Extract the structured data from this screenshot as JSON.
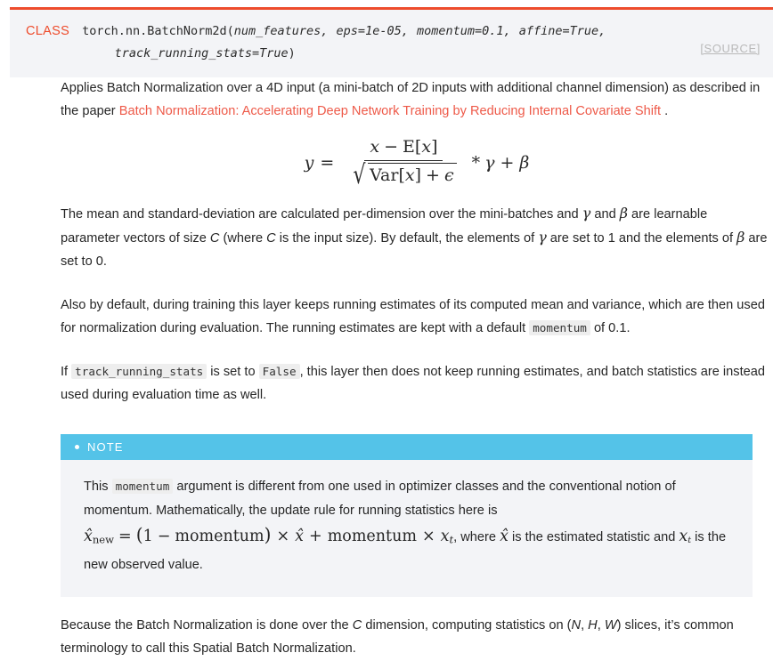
{
  "signature": {
    "keyword": "CLASS",
    "qualified_name": "torch.nn.BatchNorm2d",
    "open_paren": "(",
    "args_line1": "num_features, eps=1e-05, momentum=0.1, affine=True,",
    "args_line2": "track_running_stats=True",
    "close_paren": ")",
    "source_link": "[SOURCE]",
    "accent_color": "#ee4c2c",
    "background_color": "#f3f4f7"
  },
  "description": {
    "p1_before_link": "Applies Batch Normalization over a 4D input (a mini-batch of 2D inputs with additional channel dimension) as described in the paper ",
    "p1_link": "Batch Normalization: Accelerating Deep Network Training by Reducing Internal Covariate Shift",
    "p1_after_link": " .",
    "link_color": "#ee5a49"
  },
  "formula": {
    "lhs": "y",
    "equals": "=",
    "numerator_var": "x",
    "numerator_minus": "−",
    "numerator_expect": "E",
    "numerator_bracket_open": "[",
    "numerator_bracket_close": "]",
    "numerator_inner": "x",
    "denominator_op": "Var",
    "denominator_bracket_open": "[",
    "denominator_bracket_close": "]",
    "denominator_inner": "x",
    "denominator_plus": "+",
    "denominator_eps": "ϵ",
    "radical": "√",
    "times": "*",
    "gamma": "γ",
    "plus": "+",
    "beta": "β",
    "plain_text": "y = (x - E[x]) / sqrt(Var[x] + ϵ) * γ + β"
  },
  "paragraph2": {
    "seg1": "The mean and standard-deviation are calculated per-dimension over the mini-batches and ",
    "gamma": "γ",
    "seg2": " and ",
    "beta": "β",
    "seg3": " are learnable parameter vectors of size ",
    "c1": "C",
    "seg4": " (where ",
    "c2": "C",
    "seg5": " is the input size). By default, the elements of ",
    "gamma2": "γ",
    "seg6": " are set to 1 and the elements of ",
    "beta2": "β",
    "seg7": " are set to 0."
  },
  "paragraph3": {
    "seg1": "Also by default, during training this layer keeps running estimates of its computed mean and variance, which are then used for normalization during evaluation. The running estimates are kept with a default ",
    "code": "momentum",
    "seg2": " of 0.1."
  },
  "paragraph4": {
    "seg1": "If ",
    "code1": "track_running_stats",
    "seg2": " is set to ",
    "code2": "False",
    "seg3": ", this layer then does not keep running estimates, and batch statistics are instead used during evaluation time as well."
  },
  "note": {
    "label": "NOTE",
    "header_color": "#54c3e8",
    "body_color": "#f3f4f7",
    "seg1": "This ",
    "code": "momentum",
    "seg2": " argument is different from one used in optimizer classes and the conventional notion of momentum. Mathematically, the update rule for running statistics here is ",
    "math": {
      "xhat_new": "x̂",
      "sub_new": "new",
      "equals": "=",
      "paren_open": "(",
      "one": "1",
      "minus": "−",
      "momentum_word": "momentum",
      "paren_close": ")",
      "times": "×",
      "xhat": "x̂",
      "plus": "+",
      "momentum_word2": "momentum",
      "times2": "×",
      "x_t": "x",
      "sub_t": "t",
      "plain_text": "x̂_new = (1 − momentum) × x̂ + momentum × x_t"
    },
    "seg3": ", where ",
    "xhat_inline": "x̂",
    "seg4": " is the estimated statistic and ",
    "xt_inline_base": "x",
    "xt_inline_sub": "t",
    "seg5": " is the new observed value."
  },
  "paragraph5": {
    "seg1": "Because the Batch Normalization is done over the ",
    "c": "C",
    "seg2": " dimension, computing statistics on (",
    "n": "N",
    "comma1": ", ",
    "h": "H",
    "comma2": ", ",
    "w": "W",
    "seg3": ") slices, it’s common terminology to call this Spatial Batch Normalization."
  }
}
